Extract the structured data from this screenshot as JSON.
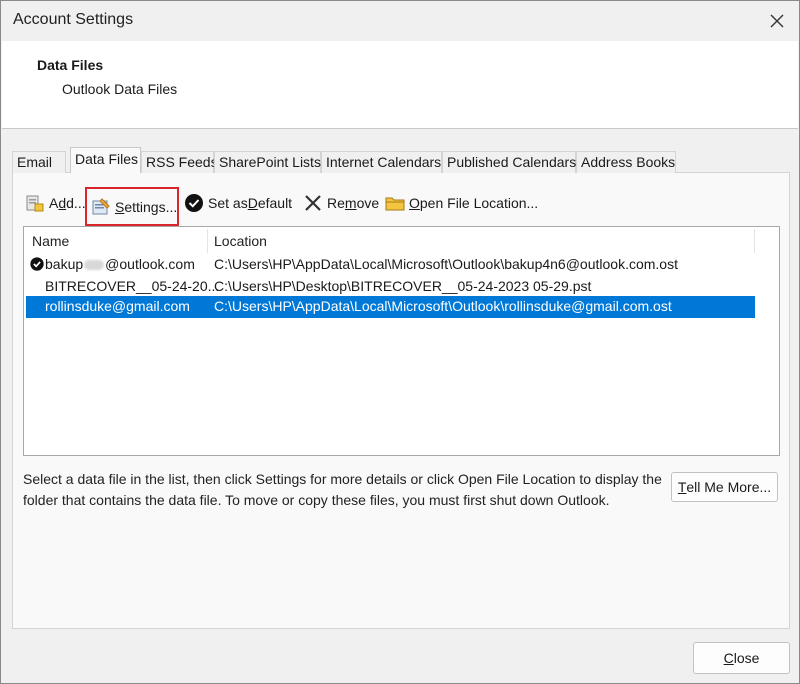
{
  "window": {
    "title": "Account Settings"
  },
  "header": {
    "title": "Data Files",
    "subtitle": "Outlook Data Files"
  },
  "tabs": [
    {
      "label": "Email",
      "active": false
    },
    {
      "label": "Data Files",
      "active": true
    },
    {
      "label": "RSS Feeds",
      "active": false
    },
    {
      "label": "SharePoint Lists",
      "active": false
    },
    {
      "label": "Internet Calendars",
      "active": false
    },
    {
      "label": "Published Calendars",
      "active": false
    },
    {
      "label": "Address Books",
      "active": false
    }
  ],
  "toolbar": {
    "add": {
      "pre": "A",
      "u": "d",
      "post": "d..."
    },
    "settings": {
      "pre": "",
      "u": "S",
      "post": "ettings..."
    },
    "set_default": {
      "pre": "Set as ",
      "u": "D",
      "post": "efault"
    },
    "remove": {
      "pre": "Re",
      "u": "m",
      "post": "ove"
    },
    "open_location": {
      "pre": "",
      "u": "O",
      "post": "pen File Location..."
    }
  },
  "list": {
    "columns": [
      "Name",
      "Location"
    ],
    "rows": [
      {
        "name_pre": "bakup",
        "name_post": "@outlook.com",
        "location": "C:\\Users\\HP\\AppData\\Local\\Microsoft\\Outlook\\bakup4n6@outlook.com.ost",
        "is_default": true,
        "selected": false
      },
      {
        "name": "BITRECOVER__05-24-20...",
        "location": "C:\\Users\\HP\\Desktop\\BITRECOVER__05-24-2023 05-29.pst",
        "is_default": false,
        "selected": false
      },
      {
        "name": "rollinsduke@gmail.com",
        "location": "C:\\Users\\HP\\AppData\\Local\\Microsoft\\Outlook\\rollinsduke@gmail.com.ost",
        "is_default": false,
        "selected": true
      }
    ]
  },
  "help_text": "Select a data file in the list, then click Settings for more details or click Open File Location to display the folder that contains the data file. To move or copy these files, you must first shut down Outlook.",
  "buttons": {
    "tell_me": {
      "pre": "",
      "u": "T",
      "post": "ell Me More..."
    },
    "close": {
      "pre": "",
      "u": "C",
      "post": "lose"
    }
  },
  "colors": {
    "selection": "#0078d7",
    "highlight_box": "#d9262b",
    "dialog_bg": "#f0f0f0"
  },
  "icons": {
    "add": "add-data-file-icon",
    "settings": "settings-icon",
    "default": "checkmark-circle-icon",
    "remove": "remove-x-icon",
    "open": "folder-icon"
  }
}
